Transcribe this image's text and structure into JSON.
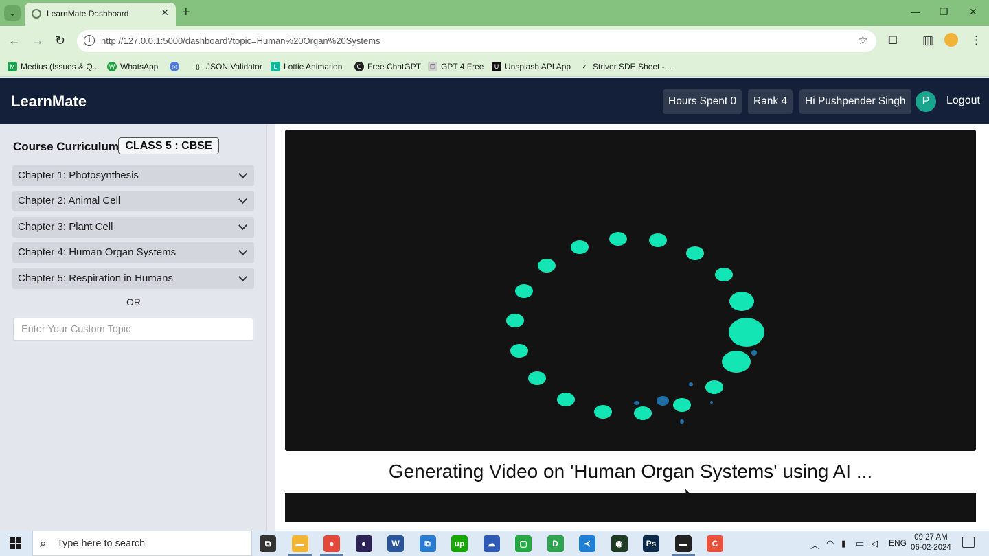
{
  "browser": {
    "tab_dropdown_icon": "⌄",
    "tab_title": "LearnMate Dashboard",
    "tab_close": "✕",
    "new_tab": "+",
    "window_controls": [
      "—",
      "❐",
      "✕"
    ],
    "url": "http://127.0.0.1:5000/dashboard?topic=Human%20Organ%20Systems",
    "bookmarks": [
      {
        "label": "Medius (Issues & Q...",
        "icon": "M",
        "color": "#18a34a"
      },
      {
        "label": "WhatsApp",
        "icon": "W",
        "color": "#25a244"
      },
      {
        "label": "",
        "icon": "◎",
        "color": "#4a78d8"
      },
      {
        "label": "JSON Validator",
        "icon": "{}",
        "color": "#444444"
      },
      {
        "label": "Lottie Animation",
        "icon": "L",
        "color": "#12b89c"
      },
      {
        "label": "Free ChatGPT",
        "icon": "G",
        "color": "#222222"
      },
      {
        "label": "GPT 4 Free",
        "icon": "❐",
        "color": "#cfcfcf"
      },
      {
        "label": "Unsplash API App",
        "icon": "U",
        "color": "#111111"
      },
      {
        "label": "Striver SDE Sheet -...",
        "icon": "✓",
        "color": "#2a2a2a"
      }
    ]
  },
  "header": {
    "brand": "LearnMate",
    "hours": "Hours Spent 0",
    "rank": "Rank 4",
    "greeting": "Hi Pushpender Singh",
    "avatar_letter": "P",
    "logout": "Logout"
  },
  "sidebar": {
    "title": "Course Curriculum",
    "class_badge": "CLASS 5 : CBSE",
    "chapters": [
      "Chapter 1: Photosynthesis",
      "Chapter 2: Animal Cell",
      "Chapter 3: Plant Cell",
      "Chapter 4: Human Organ Systems",
      "Chapter 5: Respiration in Humans"
    ],
    "or_text": "OR",
    "custom_topic_placeholder": "Enter Your Custom Topic"
  },
  "main": {
    "status_text": "Generating Video on 'Human Organ Systems' using AI ...",
    "loader_color": "#13e6b4"
  },
  "taskbar": {
    "search_placeholder": "Type here to search",
    "apps": [
      {
        "name": "task-view",
        "glyph": "⧉",
        "color": "#333333"
      },
      {
        "name": "file-explorer",
        "glyph": "▬",
        "color": "#f2b531"
      },
      {
        "name": "chrome",
        "glyph": "●",
        "color": "#e2483c"
      },
      {
        "name": "eclipse",
        "glyph": "●",
        "color": "#2c2255"
      },
      {
        "name": "word",
        "glyph": "W",
        "color": "#2b579a"
      },
      {
        "name": "remote",
        "glyph": "⧉",
        "color": "#2a7ad2"
      },
      {
        "name": "upwork",
        "glyph": "up",
        "color": "#14a800"
      },
      {
        "name": "onedrive",
        "glyph": "☁",
        "color": "#2f5bb7"
      },
      {
        "name": "code",
        "glyph": "▢",
        "color": "#27a844"
      },
      {
        "name": "dbeaver",
        "glyph": "D",
        "color": "#2ea44f"
      },
      {
        "name": "vscode",
        "glyph": "≺",
        "color": "#1f7fd4"
      },
      {
        "name": "headset",
        "glyph": "◉",
        "color": "#1e3b23"
      },
      {
        "name": "photoshop",
        "glyph": "Ps",
        "color": "#0e2a4a"
      },
      {
        "name": "terminal",
        "glyph": "▬",
        "color": "#222222"
      },
      {
        "name": "app-red",
        "glyph": "C",
        "color": "#e8513b"
      }
    ],
    "lang": "ENG",
    "time": "09:27 AM",
    "date": "06-02-2024"
  }
}
